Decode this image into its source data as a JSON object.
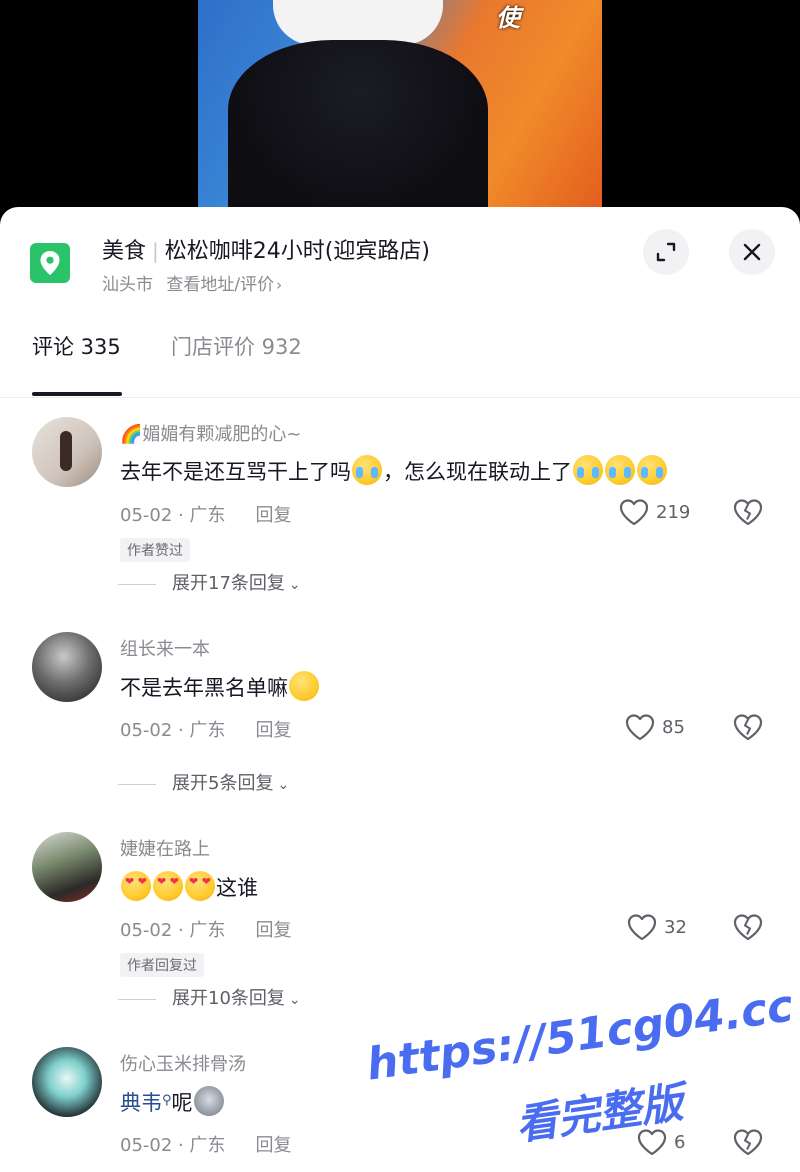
{
  "video": {
    "sticker_text": "使"
  },
  "location": {
    "category": "美食",
    "name": "松松咖啡24小时(迎宾路店)",
    "city": "汕头市",
    "link_label": "查看地址/评价"
  },
  "tabs": [
    {
      "label": "评论 335",
      "active": true
    },
    {
      "label": "门店评价 932",
      "active": false
    }
  ],
  "comments": [
    {
      "username": "🌈媚媚有颗减肥的心~",
      "text_before": "去年不是还互骂干上了吗",
      "text_middle": "，怎么现在联动上了",
      "date_loc": "05-02 · 广东",
      "reply_label": "回复",
      "likes": "219",
      "badge": "作者赞过",
      "expand_label": "展开17条回复"
    },
    {
      "username": "组长来一本",
      "text_before": "不是去年黑名单嘛",
      "date_loc": "05-02 · 广东",
      "reply_label": "回复",
      "likes": "85",
      "expand_label": "展开5条回复"
    },
    {
      "username": "婕婕在路上",
      "text_after": "这谁",
      "date_loc": "05-02 · 广东",
      "reply_label": "回复",
      "likes": "32",
      "badge": "作者回复过",
      "expand_label": "展开10条回复"
    },
    {
      "username": "伤心玉米排骨汤",
      "mention": "典韦",
      "text_after": "呢",
      "date_loc": "05-02 · 广东",
      "reply_label": "回复",
      "likes": "6"
    }
  ],
  "watermark": {
    "line1": "https://51cg04.cc",
    "line2": "看完整版"
  },
  "colors": {
    "location_icon": "#2bc36a",
    "text_primary": "#161823",
    "text_secondary": "#8a8b91",
    "watermark": "#4a6cf0"
  }
}
